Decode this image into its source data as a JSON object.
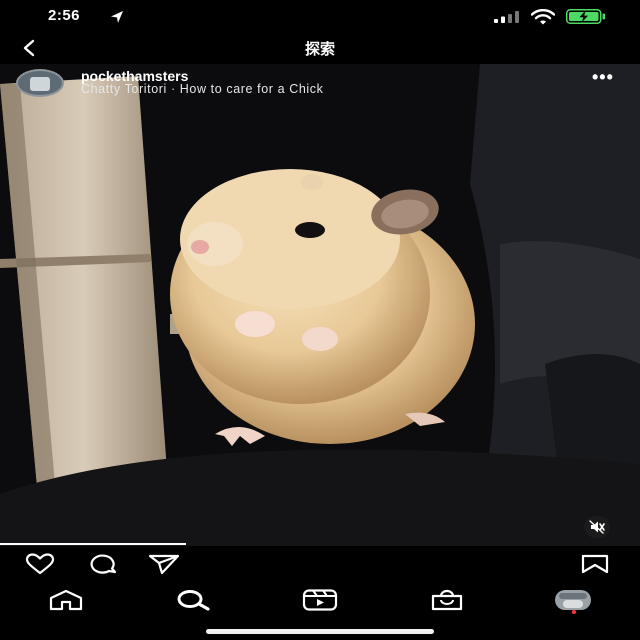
{
  "status_bar": {
    "time": "2:56"
  },
  "header": {
    "title": "探索"
  },
  "post": {
    "username": "pockethamsters",
    "audio": "Chatty Toritori · How to care for a Chick",
    "video_progress": 0.29,
    "muted": true
  },
  "colors": {
    "background": "#000000",
    "battery_green": "#4cd964",
    "notification_dot": "#ff3040"
  },
  "icons": {
    "status": [
      "location-arrow-icon",
      "cellular-signal-icon",
      "wifi-icon",
      "battery-charging-icon"
    ],
    "header": [
      "back-chevron-icon"
    ],
    "post": [
      "more-options-icon",
      "mute-icon"
    ],
    "actions": [
      "heart-icon",
      "comment-icon",
      "share-icon",
      "bookmark-icon"
    ],
    "bottom_nav": [
      "home-icon",
      "search-icon",
      "reels-icon",
      "shop-icon",
      "profile-avatar"
    ]
  }
}
